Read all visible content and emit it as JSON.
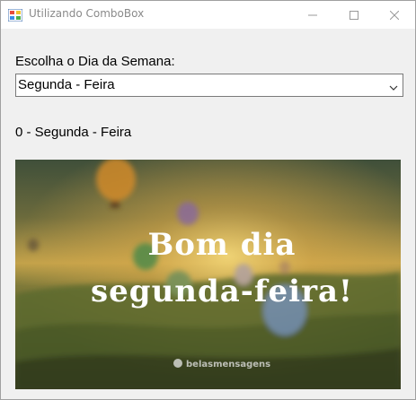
{
  "window": {
    "title": "Utilizando ComboBox",
    "buttons": [
      "minimize",
      "maximize",
      "close"
    ]
  },
  "form": {
    "prompt_label": "Escolha o Dia da Semana:",
    "combobox": {
      "selected_value": "Segunda - Feira",
      "icon": "chevron-down-icon"
    },
    "result_label": "0 - Segunda - Feira"
  },
  "picture": {
    "line1": "Bom dia",
    "line2": "segunda-feira!",
    "watermark": "belasmensagens"
  }
}
